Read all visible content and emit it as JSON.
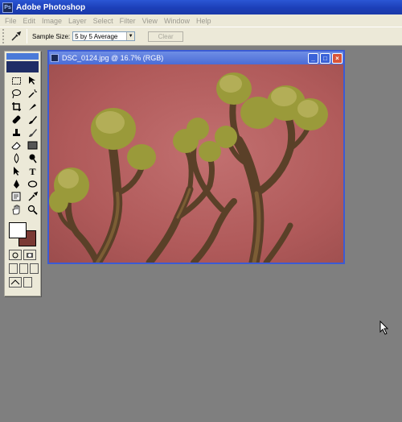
{
  "app": {
    "title": "Adobe Photoshop",
    "logo_text": "Ps"
  },
  "menu": [
    "File",
    "Edit",
    "Image",
    "Layer",
    "Select",
    "Filter",
    "View",
    "Window",
    "Help"
  ],
  "options_bar": {
    "tool_icon": "eyedropper-icon",
    "sample_size_label": "Sample Size:",
    "sample_size_value": "5 by 5 Average",
    "clear_label": "Clear"
  },
  "document": {
    "title": "DSC_0124.jpg @ 16.7% (RGB)",
    "buttons": {
      "minimize": "_",
      "maximize": "□",
      "close": "×"
    },
    "image_subject": "joshua-tree-photo"
  },
  "toolbox": {
    "tools": [
      "marquee-icon",
      "move-icon",
      "lasso-icon",
      "magic-wand-icon",
      "crop-icon",
      "slice-icon",
      "healing-brush-icon",
      "brush-icon",
      "stamp-icon",
      "history-brush-icon",
      "eraser-icon",
      "gradient-icon",
      "blur-icon",
      "dodge-icon",
      "path-select-icon",
      "type-icon",
      "pen-icon",
      "shape-icon",
      "notes-icon",
      "eyedropper-icon",
      "hand-icon",
      "zoom-icon"
    ],
    "foreground_color": "#ffffff",
    "background_color": "#7a3a34"
  },
  "colors": {
    "desktop": "#7f7f7f",
    "titlebar": "#1c3fb8",
    "canvas_sky": "#b65e5e"
  }
}
